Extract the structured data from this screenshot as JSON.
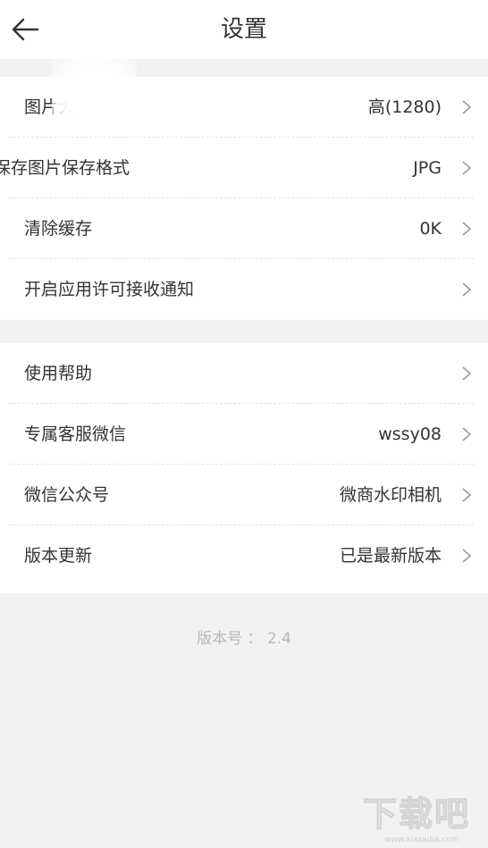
{
  "header": {
    "title": "设置"
  },
  "settings_group_1": [
    {
      "label": "图片大小",
      "value": "高(1280)"
    },
    {
      "label": "保存图片保存格式",
      "value": "JPG"
    },
    {
      "label": "清除缓存",
      "value": "0K"
    },
    {
      "label": "开启应用许可接收通知",
      "value": ""
    }
  ],
  "settings_group_2": [
    {
      "label": "使用帮助",
      "value": ""
    },
    {
      "label": "专属客服微信",
      "value": "wssy08"
    },
    {
      "label": "微信公众号",
      "value": "微商水印相机"
    },
    {
      "label": "版本更新",
      "value": "已是最新版本"
    }
  ],
  "footer": {
    "version": "版本号 ： 2.4"
  },
  "watermark": {
    "text": "下载吧",
    "url": "www.xiazaiba.com"
  },
  "colors": {
    "background": "#f2f2f2",
    "card": "#ffffff",
    "text": "#333333",
    "muted": "#b8b8b8",
    "chevron": "#9a9a9a"
  },
  "icons": {
    "back": "arrow-left-icon",
    "chevron": "chevron-right-icon"
  }
}
